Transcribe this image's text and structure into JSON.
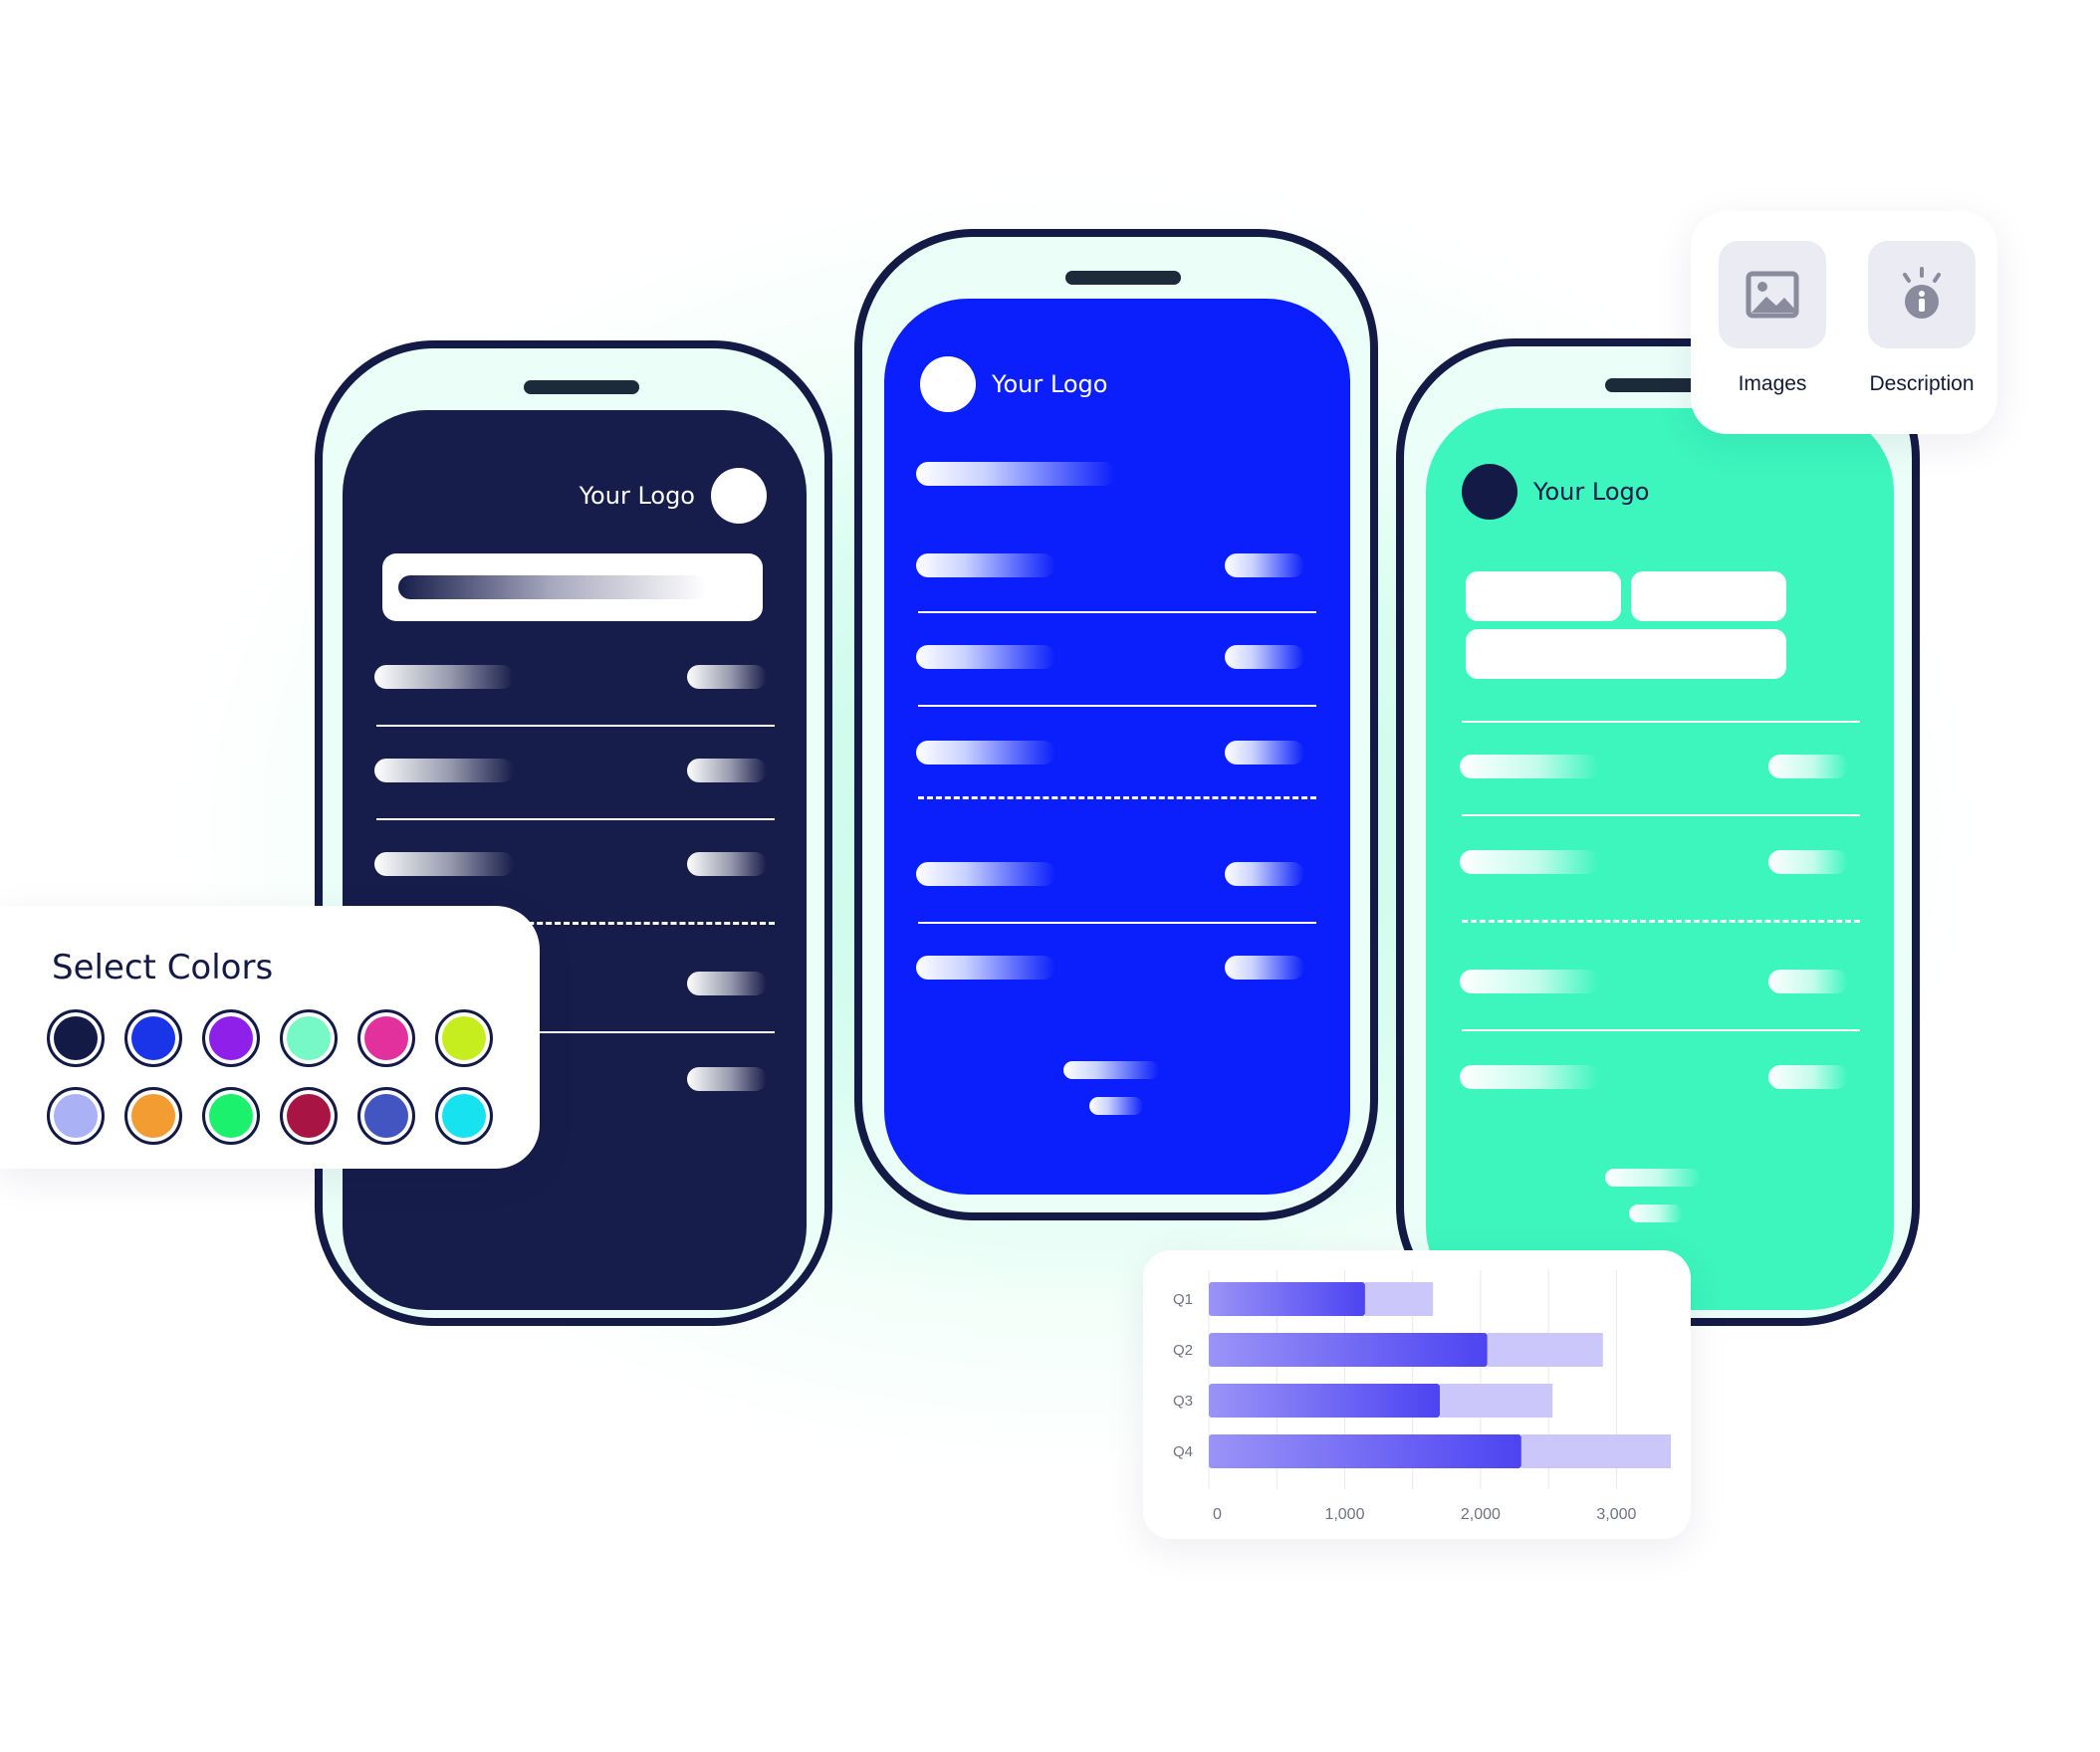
{
  "phones": [
    {
      "logo_text": "Your Logo",
      "screen_color": "#161d4a"
    },
    {
      "logo_text": "Your Logo",
      "screen_color": "#0a1ffb"
    },
    {
      "logo_text": "Your Logo",
      "screen_color": "#3cf6bd"
    }
  ],
  "color_picker": {
    "title": "Select Colors",
    "swatches": [
      "#141a46",
      "#1a35e8",
      "#8f20ea",
      "#76f9c6",
      "#e2319c",
      "#c6ee1f",
      "#aab2f5",
      "#f39c31",
      "#1cf16e",
      "#a81443",
      "#4355c1",
      "#17e2ef"
    ]
  },
  "media_panel": {
    "images_label": "Images",
    "description_label": "Description",
    "icons": [
      "image-icon",
      "info-icon"
    ]
  },
  "chart_data": {
    "type": "bar",
    "categories": [
      "Q1",
      "Q2",
      "Q3",
      "Q4"
    ],
    "series": [
      {
        "values": [
          1150,
          2050,
          1700,
          2300
        ],
        "color": "#4d43f2"
      },
      {
        "values": [
          500,
          850,
          830,
          1100
        ],
        "color": "#cbc7fa"
      }
    ],
    "stacked": true,
    "orientation": "horizontal",
    "xticks": [
      0,
      1000,
      2000,
      3000
    ],
    "xtick_labels": [
      "0",
      "1,000",
      "2,000",
      "3,000"
    ],
    "xlim": [
      0,
      3400
    ],
    "grid": true
  }
}
